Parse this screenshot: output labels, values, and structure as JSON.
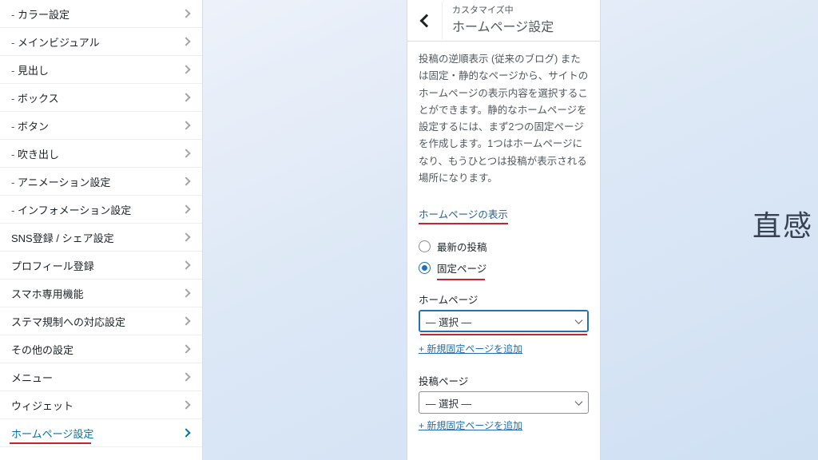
{
  "sidebar": {
    "items": [
      {
        "label": "カラー設定",
        "sub": true
      },
      {
        "label": "メインビジュアル",
        "sub": true
      },
      {
        "label": "見出し",
        "sub": true
      },
      {
        "label": "ボックス",
        "sub": true
      },
      {
        "label": "ボタン",
        "sub": true
      },
      {
        "label": "吹き出し",
        "sub": true
      },
      {
        "label": "アニメーション設定",
        "sub": true
      },
      {
        "label": "インフォメーション設定",
        "sub": true
      },
      {
        "label": "SNS登録 / シェア設定",
        "sub": false
      },
      {
        "label": "プロフィール登録",
        "sub": false
      },
      {
        "label": "スマホ専用機能",
        "sub": false
      },
      {
        "label": "ステマ規制への対応設定",
        "sub": false
      },
      {
        "label": "その他の設定",
        "sub": false
      },
      {
        "label": "メニュー",
        "sub": false
      },
      {
        "label": "ウィジェット",
        "sub": false
      },
      {
        "label": "ホームページ設定",
        "sub": false,
        "active": true
      }
    ]
  },
  "panel": {
    "crumb": "カスタマイズ中",
    "title": "ホームページ設定",
    "description": "投稿の逆順表示 (従来のブログ) または固定・静的なページから、サイトのホームページの表示内容を選択することができます。静的なホームページを設定するには、まず2つの固定ページを作成します。1つはホームページになり、もうひとつは投稿が表示される場所になります。",
    "display_section": "ホームページの表示",
    "option_latest": "最新の投稿",
    "option_fixed": "固定ページ",
    "homepage_label": "ホームページ",
    "posts_label": "投稿ページ",
    "select_placeholder": "— 選択 —",
    "add_link": "+ 新規固定ページを追加"
  },
  "preview": {
    "headline_fragment": "直感"
  }
}
